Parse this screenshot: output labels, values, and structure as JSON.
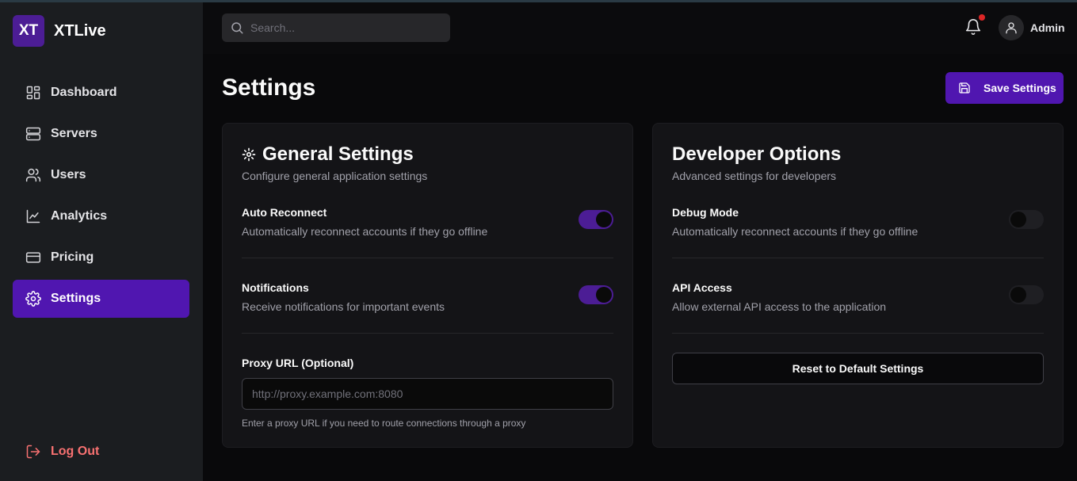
{
  "brand": {
    "logo_text": "XT",
    "name": "XTLive"
  },
  "sidebar": {
    "items": [
      {
        "label": "Dashboard",
        "icon": "dashboard-icon"
      },
      {
        "label": "Servers",
        "icon": "server-icon"
      },
      {
        "label": "Users",
        "icon": "users-icon"
      },
      {
        "label": "Analytics",
        "icon": "analytics-icon"
      },
      {
        "label": "Pricing",
        "icon": "credit-card-icon"
      },
      {
        "label": "Settings",
        "icon": "gear-icon",
        "active": true
      }
    ],
    "logout_label": "Log Out"
  },
  "header": {
    "search_placeholder": "Search...",
    "user_name": "Admin",
    "has_notification": true
  },
  "page": {
    "title": "Settings",
    "save_label": "Save Settings"
  },
  "general": {
    "title": "General Settings",
    "subtitle": "Configure general application settings",
    "auto_reconnect": {
      "label": "Auto Reconnect",
      "desc": "Automatically reconnect accounts if they go offline",
      "enabled": true
    },
    "notifications": {
      "label": "Notifications",
      "desc": "Receive notifications for important events",
      "enabled": true
    },
    "proxy": {
      "label": "Proxy URL (Optional)",
      "placeholder": "http://proxy.example.com:8080",
      "value": "",
      "help": "Enter a proxy URL if you need to route connections through a proxy"
    }
  },
  "developer": {
    "title": "Developer Options",
    "subtitle": "Advanced settings for developers",
    "debug_mode": {
      "label": "Debug Mode",
      "desc": "Automatically reconnect accounts if they go offline",
      "enabled": false
    },
    "api_access": {
      "label": "API Access",
      "desc": "Allow external API access to the application",
      "enabled": false
    },
    "reset_label": "Reset to Default Settings"
  },
  "colors": {
    "accent": "#5016b0",
    "background": "#09090b",
    "sidebar": "#1b1d20",
    "card": "#141417",
    "danger": "#f87171"
  }
}
